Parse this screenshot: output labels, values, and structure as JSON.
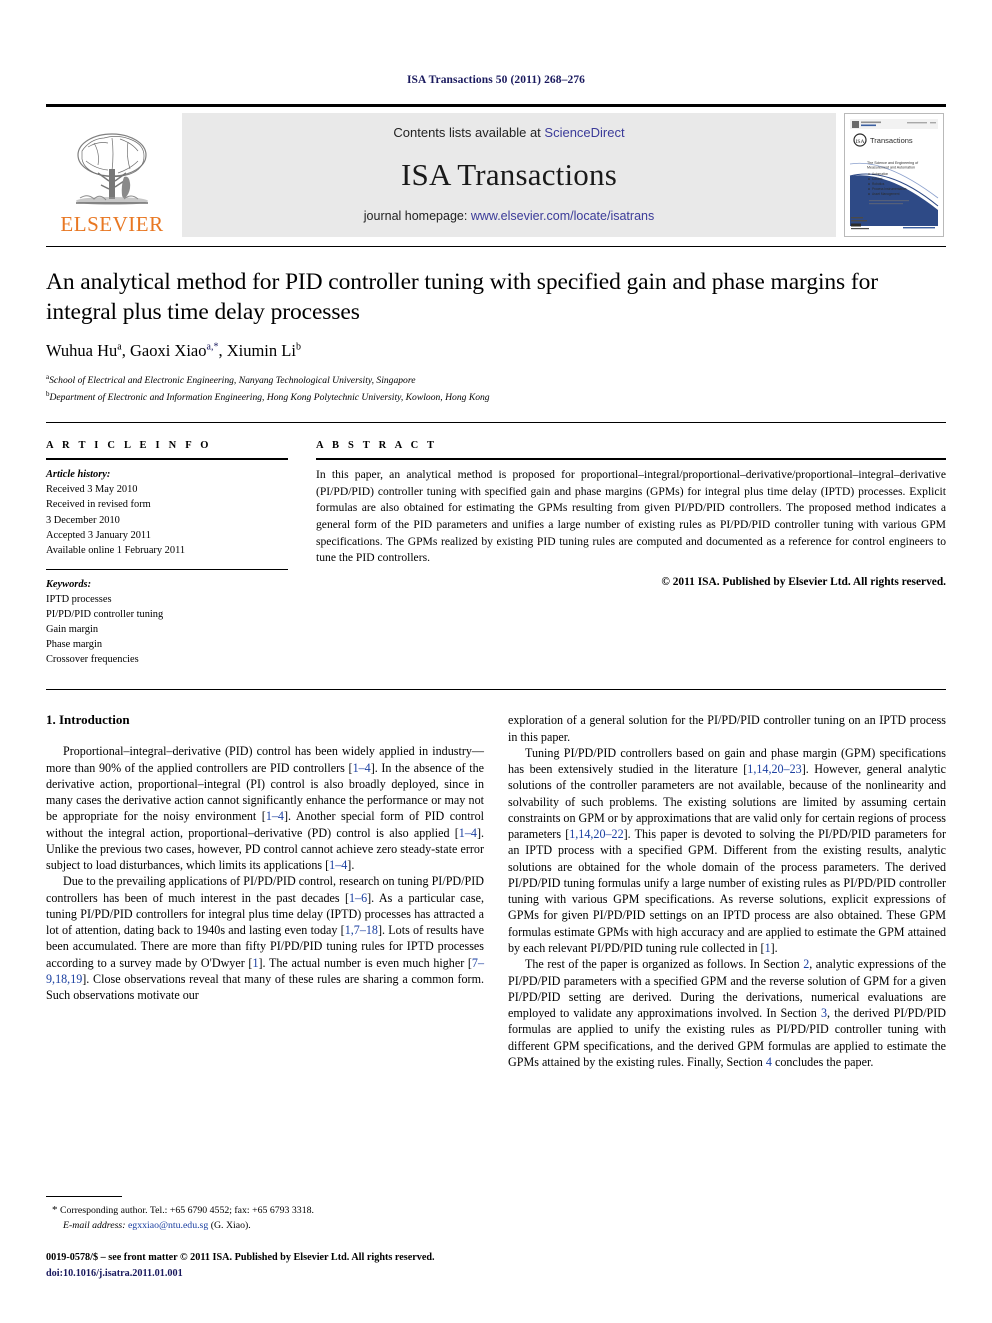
{
  "running_head": "ISA Transactions 50 (2011) 268–276",
  "masthead": {
    "publisher_name": "ELSEVIER",
    "contents_prefix": "Contents lists available at ",
    "contents_link": "ScienceDirect",
    "journal_name": "ISA Transactions",
    "homepage_prefix": "journal homepage: ",
    "homepage_link": "www.elsevier.com/locate/isatrans",
    "cover": {
      "brand": "ScienceDirect",
      "logo_text": "Transactions",
      "logo_mark": "ISA",
      "tagline": "The Science and Engineering of Measurement and Automation",
      "bullets": [
        "Automation",
        "Control",
        "Instrumentation",
        "Process Instrumentation",
        "Asset Management"
      ],
      "footer_link": "http://www.elsevier.com/locate/isatrans"
    },
    "link_color": "#3b3b99",
    "elsevier_orange": "#E87722"
  },
  "title": "An analytical method for PID controller tuning with specified gain and phase margins for integral plus time delay processes",
  "authors": [
    {
      "name": "Wuhua Hu",
      "sup": "a"
    },
    {
      "name": "Gaoxi Xiao",
      "sup": "a,*"
    },
    {
      "name": "Xiumin Li",
      "sup": "b"
    }
  ],
  "affiliations": [
    {
      "marker": "a",
      "text": "School of Electrical and Electronic Engineering, Nanyang Technological University, Singapore"
    },
    {
      "marker": "b",
      "text": "Department of Electronic and Information Engineering, Hong Kong Polytechnic University, Kowloon, Hong Kong"
    }
  ],
  "article_info": {
    "heading": "A R T I C L E   I N F O",
    "history_label": "Article history:",
    "history": [
      "Received 3 May 2010",
      "Received in revised form",
      "3 December 2010",
      "Accepted 3 January 2011",
      "Available online 1 February 2011"
    ],
    "keywords_label": "Keywords:",
    "keywords": [
      "IPTD processes",
      "PI/PD/PID controller tuning",
      "Gain margin",
      "Phase margin",
      "Crossover frequencies"
    ]
  },
  "abstract": {
    "heading": "A B S T R A C T",
    "text": "In this paper, an analytical method is proposed for proportional–integral/proportional–derivative/proportional–integral–derivative (PI/PD/PID) controller tuning with specified gain and phase margins (GPMs) for integral plus time delay (IPTD) processes. Explicit formulas are also obtained for estimating the GPMs resulting from given PI/PD/PID controllers. The proposed method indicates a general form of the PID parameters and unifies a large number of existing rules as PI/PD/PID controller tuning with various GPM specifications. The GPMs realized by existing PID tuning rules are computed and documented as a reference for control engineers to tune the PID controllers.",
    "copyright": "© 2011 ISA. Published by Elsevier Ltd. All rights reserved."
  },
  "body": {
    "section_heading": "1. Introduction",
    "left_paragraphs": [
      "Proportional–integral–derivative (PID) control has been widely applied in industry—more than 90% of the applied controllers are PID controllers [1–4]. In the absence of the derivative action, proportional–integral (PI) control is also broadly deployed, since in many cases the derivative action cannot significantly enhance the performance or may not be appropriate for the noisy environment [1–4]. Another special form of PID control without the integral action, proportional–derivative (PD) control is also applied [1–4]. Unlike the previous two cases, however, PD control cannot achieve zero steady-state error subject to load disturbances, which limits its applications [1–4].",
      "Due to the prevailing applications of PI/PD/PID control, research on tuning PI/PD/PID controllers has been of much interest in the past decades [1–6]. As a particular case, tuning PI/PD/PID controllers for integral plus time delay (IPTD) processes has attracted a lot of attention, dating back to 1940s and lasting even today [1,7–18]. Lots of results have been accumulated. There are more than fifty PI/PD/PID tuning rules for IPTD processes according to a survey made by O'Dwyer [1]. The actual number is even much higher [7–9,18,19]. Close observations reveal that many of these rules are sharing a common form. Such observations motivate our"
    ],
    "right_paragraphs": [
      "exploration of a general solution for the PI/PD/PID controller tuning on an IPTD process in this paper.",
      "Tuning PI/PD/PID controllers based on gain and phase margin (GPM) specifications has been extensively studied in the literature [1,14,20–23]. However, general analytic solutions of the controller parameters are not available, because of the nonlinearity and solvability of such problems. The existing solutions are limited by assuming certain constraints on GPM or by approximations that are valid only for certain regions of process parameters [1,14,20–22]. This paper is devoted to solving the PI/PD/PID parameters for an IPTD process with a specified GPM. Different from the existing results, analytic solutions are obtained for the whole domain of the process parameters. The derived PI/PD/PID tuning formulas unify a large number of existing rules as PI/PD/PID controller tuning with various GPM specifications. As reverse solutions, explicit expressions of GPMs for given PI/PD/PID settings on an IPTD process are also obtained. These GPM formulas estimate GPMs with high accuracy and are applied to estimate the GPM attained by each relevant PI/PD/PID tuning rule collected in [1].",
      "The rest of the paper is organized as follows. In Section 2, analytic expressions of the PI/PD/PID parameters with a specified GPM and the reverse solution of GPM for a given PI/PD/PID setting are derived. During the derivations, numerical evaluations are employed to validate any approximations involved. In Section 3, the derived PI/PD/PID formulas are applied to unify the existing rules as PI/PD/PID controller tuning with different GPM specifications, and the derived GPM formulas are applied to estimate the GPMs attained by the existing rules. Finally, Section 4 concludes the paper."
    ]
  },
  "footnotes": {
    "corresponding_marker": "*",
    "corresponding_text": "Corresponding author. Tel.: +65 6790 4552; fax: +65 6793 3318.",
    "email_label": "E-mail address:",
    "email": "egxxiao@ntu.edu.sg",
    "email_owner": "(G. Xiao).",
    "imprint": "0019-0578/$ – see front matter © 2011 ISA. Published by Elsevier Ltd. All rights reserved.",
    "doi": "doi:10.1016/j.isatra.2011.01.001"
  }
}
